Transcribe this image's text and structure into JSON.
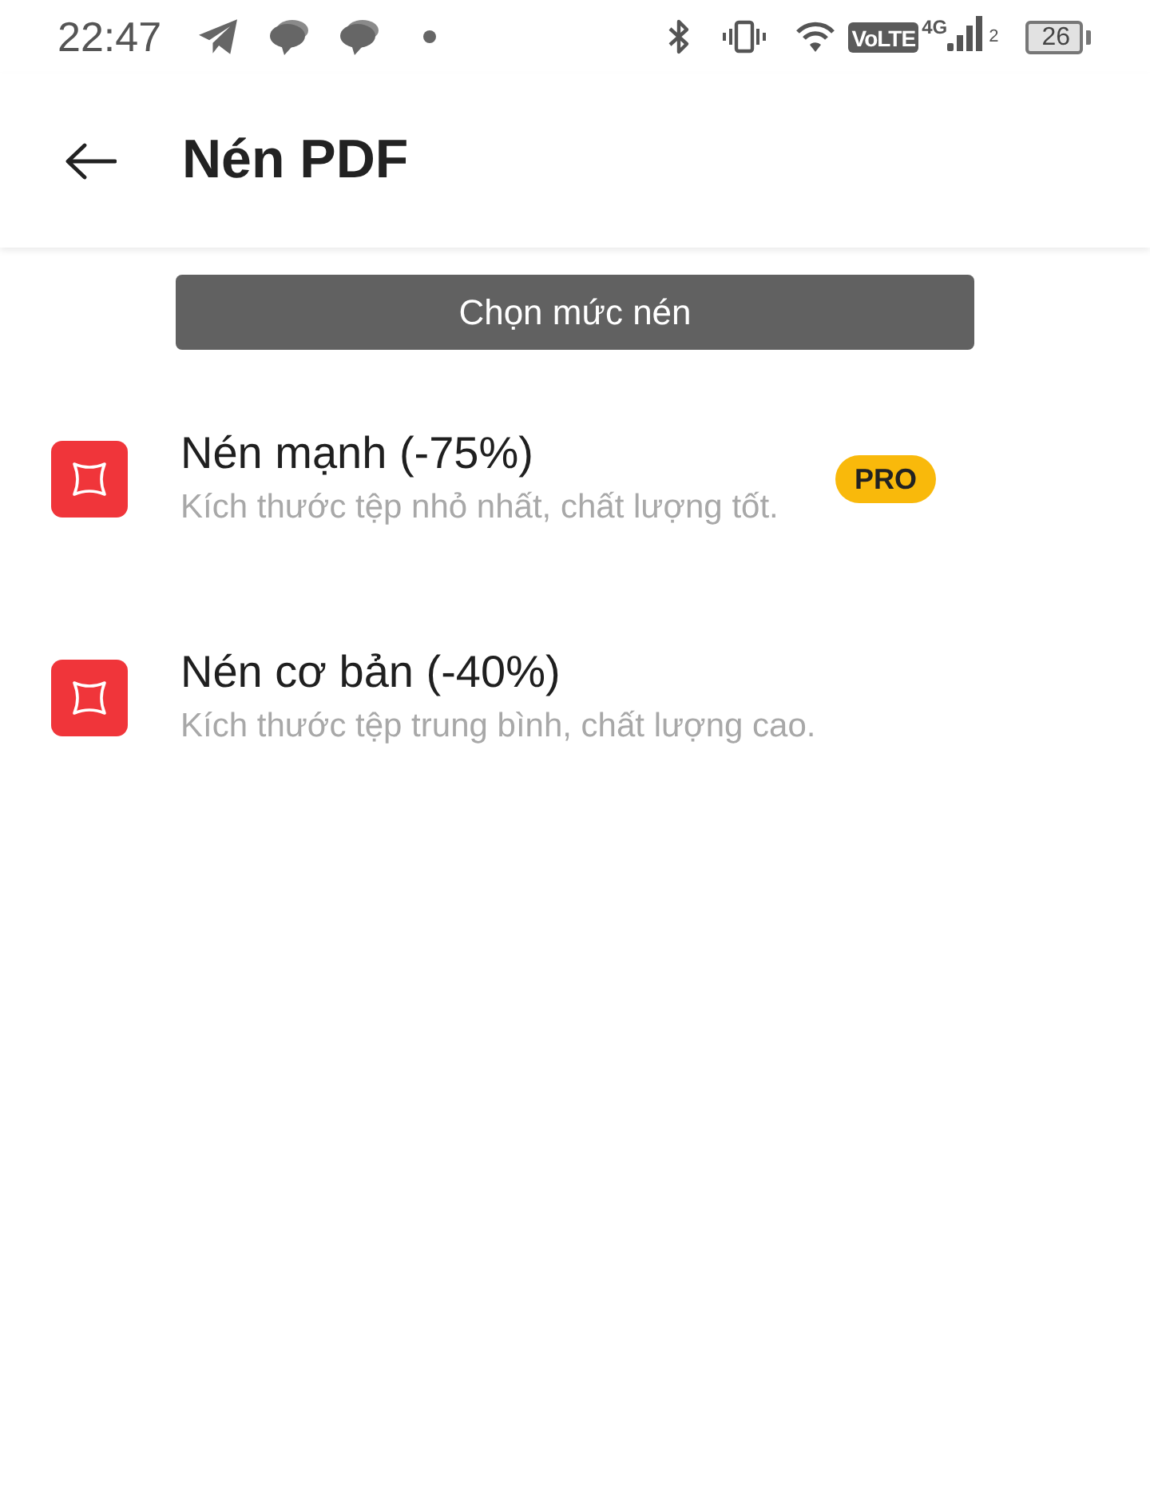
{
  "status_bar": {
    "time": "22:47",
    "network_label": "VoLTE",
    "network_type": "4G",
    "sim_slot": "2",
    "battery": "26"
  },
  "header": {
    "title": "Nén PDF"
  },
  "section_header": "Chọn mức nén",
  "options": [
    {
      "title": "Nén mạnh (-75%)",
      "description": "Kích thước tệp nhỏ nhất, chất lượng tốt.",
      "badge": "PRO"
    },
    {
      "title": "Nén cơ bản (-40%)",
      "description": "Kích thước tệp trung bình, chất lượng cao."
    }
  ]
}
